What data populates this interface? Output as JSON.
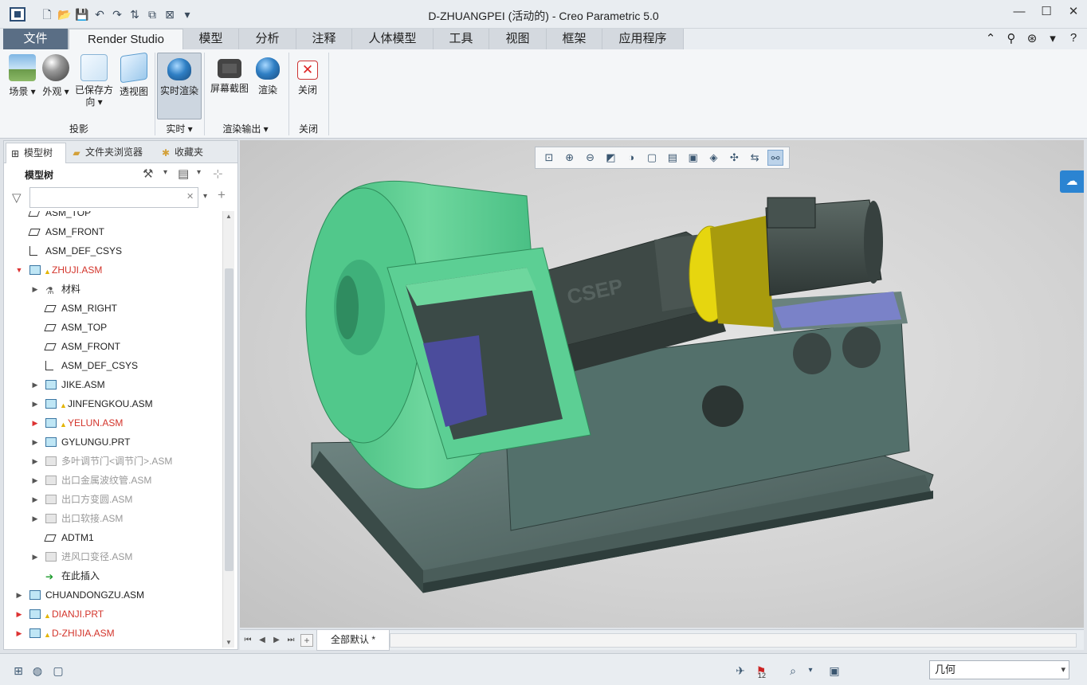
{
  "window": {
    "title": "D-ZHUANGPEI (活动的) - Creo Parametric 5.0",
    "min_glyph": "—",
    "max_glyph": "☐",
    "close_glyph": "✕"
  },
  "ribbon_tabs": [
    "文件",
    "Render Studio",
    "模型",
    "分析",
    "注释",
    "人体模型",
    "工具",
    "视图",
    "框架",
    "应用程序"
  ],
  "ribbon": {
    "groups": {
      "projection": "投影",
      "realtime": "实时 ▾",
      "render_output": "渲染输出 ▾",
      "close": "关闭"
    },
    "buttons": {
      "scene": "场景 ▾",
      "appearance": "外观 ▾",
      "saved_orient": "已保存方向 ▾",
      "perspective": "透视图",
      "realtime_render": "实时渲染",
      "screenshot": "屏幕截图",
      "render": "渲染",
      "close": "关闭"
    }
  },
  "panel": {
    "tabs": [
      "模型树",
      "文件夹浏览器",
      "收藏夹"
    ],
    "tree_label": "模型树",
    "filter_placeholder": "",
    "filter_clear": "✕",
    "add": "+"
  },
  "tree": [
    {
      "label": "ASM_TOP",
      "type": "plane",
      "level": 0,
      "state": "normal",
      "expander": ""
    },
    {
      "label": "ASM_FRONT",
      "type": "plane",
      "level": 0,
      "state": "normal",
      "expander": ""
    },
    {
      "label": "ASM_DEF_CSYS",
      "type": "csys",
      "level": 0,
      "state": "normal",
      "expander": ""
    },
    {
      "label": "ZHUJI.ASM",
      "type": "asm",
      "level": 0,
      "state": "red",
      "expander": "down-red",
      "warn": true
    },
    {
      "label": "材料",
      "type": "material",
      "level": 1,
      "state": "normal",
      "expander": "right"
    },
    {
      "label": "ASM_RIGHT",
      "type": "plane",
      "level": 1,
      "state": "normal",
      "expander": ""
    },
    {
      "label": "ASM_TOP",
      "type": "plane",
      "level": 1,
      "state": "normal",
      "expander": ""
    },
    {
      "label": "ASM_FRONT",
      "type": "plane",
      "level": 1,
      "state": "normal",
      "expander": ""
    },
    {
      "label": "ASM_DEF_CSYS",
      "type": "csys",
      "level": 1,
      "state": "normal",
      "expander": ""
    },
    {
      "label": "JIKE.ASM",
      "type": "asm",
      "level": 1,
      "state": "normal",
      "expander": "right"
    },
    {
      "label": "JINFENGKOU.ASM",
      "type": "asm",
      "level": 1,
      "state": "normal",
      "expander": "right",
      "warn": true
    },
    {
      "label": "YELUN.ASM",
      "type": "asm",
      "level": 1,
      "state": "red",
      "expander": "right-red",
      "warn": true
    },
    {
      "label": "GYLUNGU.PRT",
      "type": "asm",
      "level": 1,
      "state": "normal",
      "expander": "right"
    },
    {
      "label": "多叶调节门<调节门>.ASM",
      "type": "asm",
      "level": 1,
      "state": "gray",
      "expander": "right"
    },
    {
      "label": "出口金属波纹管.ASM",
      "type": "asm",
      "level": 1,
      "state": "gray",
      "expander": "right"
    },
    {
      "label": "出口方变圆.ASM",
      "type": "asm",
      "level": 1,
      "state": "gray",
      "expander": "right"
    },
    {
      "label": "出口软接.ASM",
      "type": "asm",
      "level": 1,
      "state": "gray",
      "expander": "right"
    },
    {
      "label": "ADTM1",
      "type": "plane",
      "level": 1,
      "state": "normal",
      "expander": ""
    },
    {
      "label": "进风口变径.ASM",
      "type": "asm",
      "level": 1,
      "state": "gray",
      "expander": "right"
    },
    {
      "label": "在此插入",
      "type": "insert",
      "level": 1,
      "state": "normal",
      "expander": ""
    },
    {
      "label": "CHUANDONGZU.ASM",
      "type": "asm",
      "level": 0,
      "state": "normal",
      "expander": "right"
    },
    {
      "label": "DIANJI.PRT",
      "type": "asm",
      "level": 0,
      "state": "red",
      "expander": "right-red",
      "warn": true
    },
    {
      "label": "D-ZHIJIA.ASM",
      "type": "asm",
      "level": 0,
      "state": "red",
      "expander": "right-red",
      "warn": true
    }
  ],
  "model": {
    "brand_text": "CSEP"
  },
  "sheet": {
    "tab": "全部默认 *",
    "nav": [
      "⏮",
      "◀",
      "▶",
      "⏭"
    ],
    "add": "+"
  },
  "status": {
    "geometry_filter": "几何",
    "flag_count": "12"
  },
  "colors": {
    "fan_housing": "#55c98c",
    "base_frame": "#4f6663",
    "motor": "#3f4a47",
    "coupling_yellow": "#e6d60f",
    "motor_plate": "#7a82c8",
    "file_tab": "#5a6e85",
    "cloud_button": "#2b84d2"
  }
}
